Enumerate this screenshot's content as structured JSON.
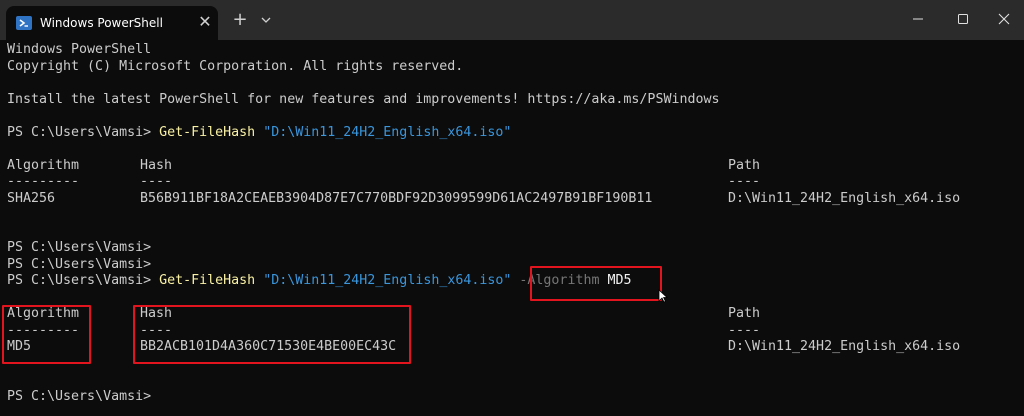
{
  "titlebar": {
    "tab_title": "Windows PowerShell",
    "close_tab_glyph": "✕",
    "new_tab_glyph": "+",
    "icons": [
      "powershell-icon",
      "close-icon",
      "plus-icon",
      "chevron-down-icon",
      "minimize-icon",
      "maximize-icon",
      "close-window-icon"
    ]
  },
  "terminal": {
    "banner1": "Windows PowerShell",
    "banner2": "Copyright (C) Microsoft Corporation. All rights reserved.",
    "banner3": "Install the latest PowerShell for new features and improvements! https://aka.ms/PSWindows",
    "prompt": "PS C:\\Users\\Vamsi>",
    "cmd_name": "Get-FileHash",
    "cmd_path": "\"D:\\Win11_24H2_English_x64.iso\"",
    "param_name": "-Algorithm",
    "param_value": "MD5",
    "result1": {
      "headers": [
        "Algorithm",
        "Hash",
        "Path"
      ],
      "underlines": [
        "---------",
        "----",
        "----"
      ],
      "row": [
        "SHA256",
        "B56B911BF18A2CEAEB3904D87E7C770BDF92D3099599D61AC2497B91BF190B11",
        "D:\\Win11_24H2_English_x64.iso"
      ]
    },
    "result2": {
      "headers": [
        "Algorithm",
        "Hash",
        "Path"
      ],
      "underlines": [
        "---------",
        "----",
        "----"
      ],
      "row": [
        "MD5",
        "BB2ACB101D4A360C71530E4BE00EC43C",
        "D:\\Win11_24H2_English_x64.iso"
      ]
    }
  },
  "colors": {
    "background": "#0c0c0c",
    "titlebar": "#2b2b2b",
    "command": "#f9f1a5",
    "string": "#3a96dd",
    "parameter": "#767676",
    "highlight": "#e2141d"
  }
}
